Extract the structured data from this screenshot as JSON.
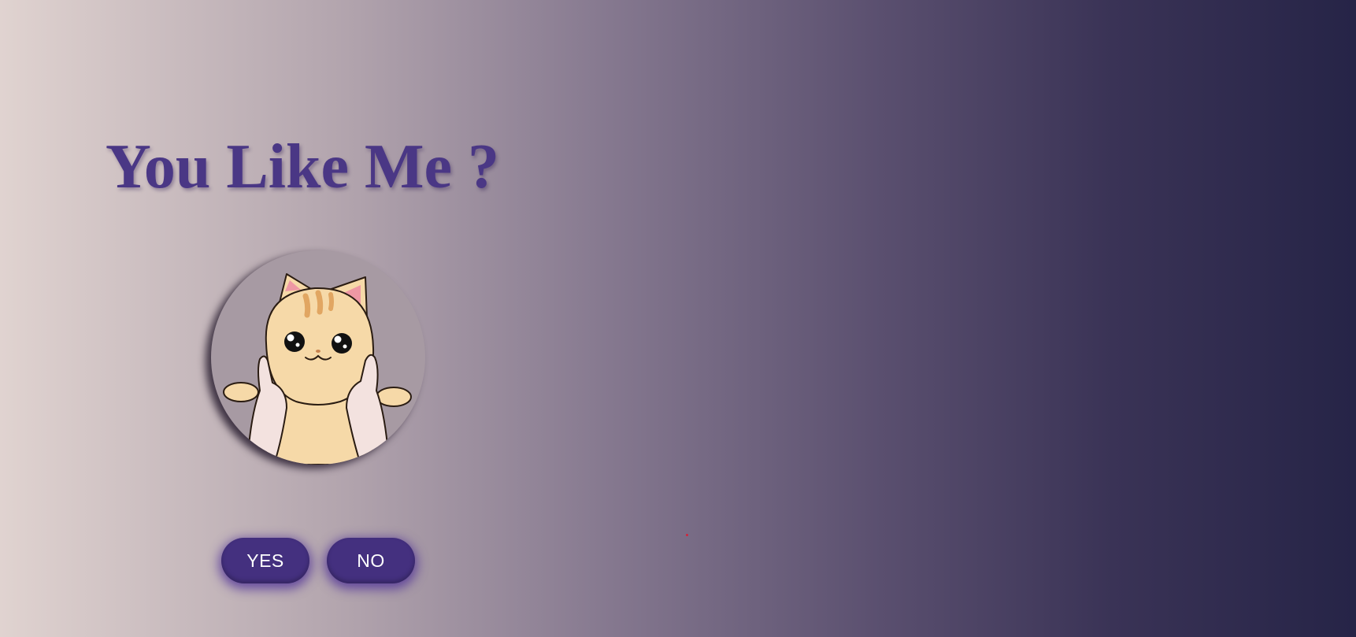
{
  "page": {
    "title": "You Like Me ?",
    "background_colors": [
      "#e0d3d0",
      "#85788f",
      "#262447"
    ],
    "accent_color": "#44307f",
    "title_color": "#4a3785"
  },
  "image": {
    "icon": "cat-icon",
    "description_color_fur": "#f6d9a8"
  },
  "buttons": {
    "yes_label": "YES",
    "no_label": "NO"
  }
}
